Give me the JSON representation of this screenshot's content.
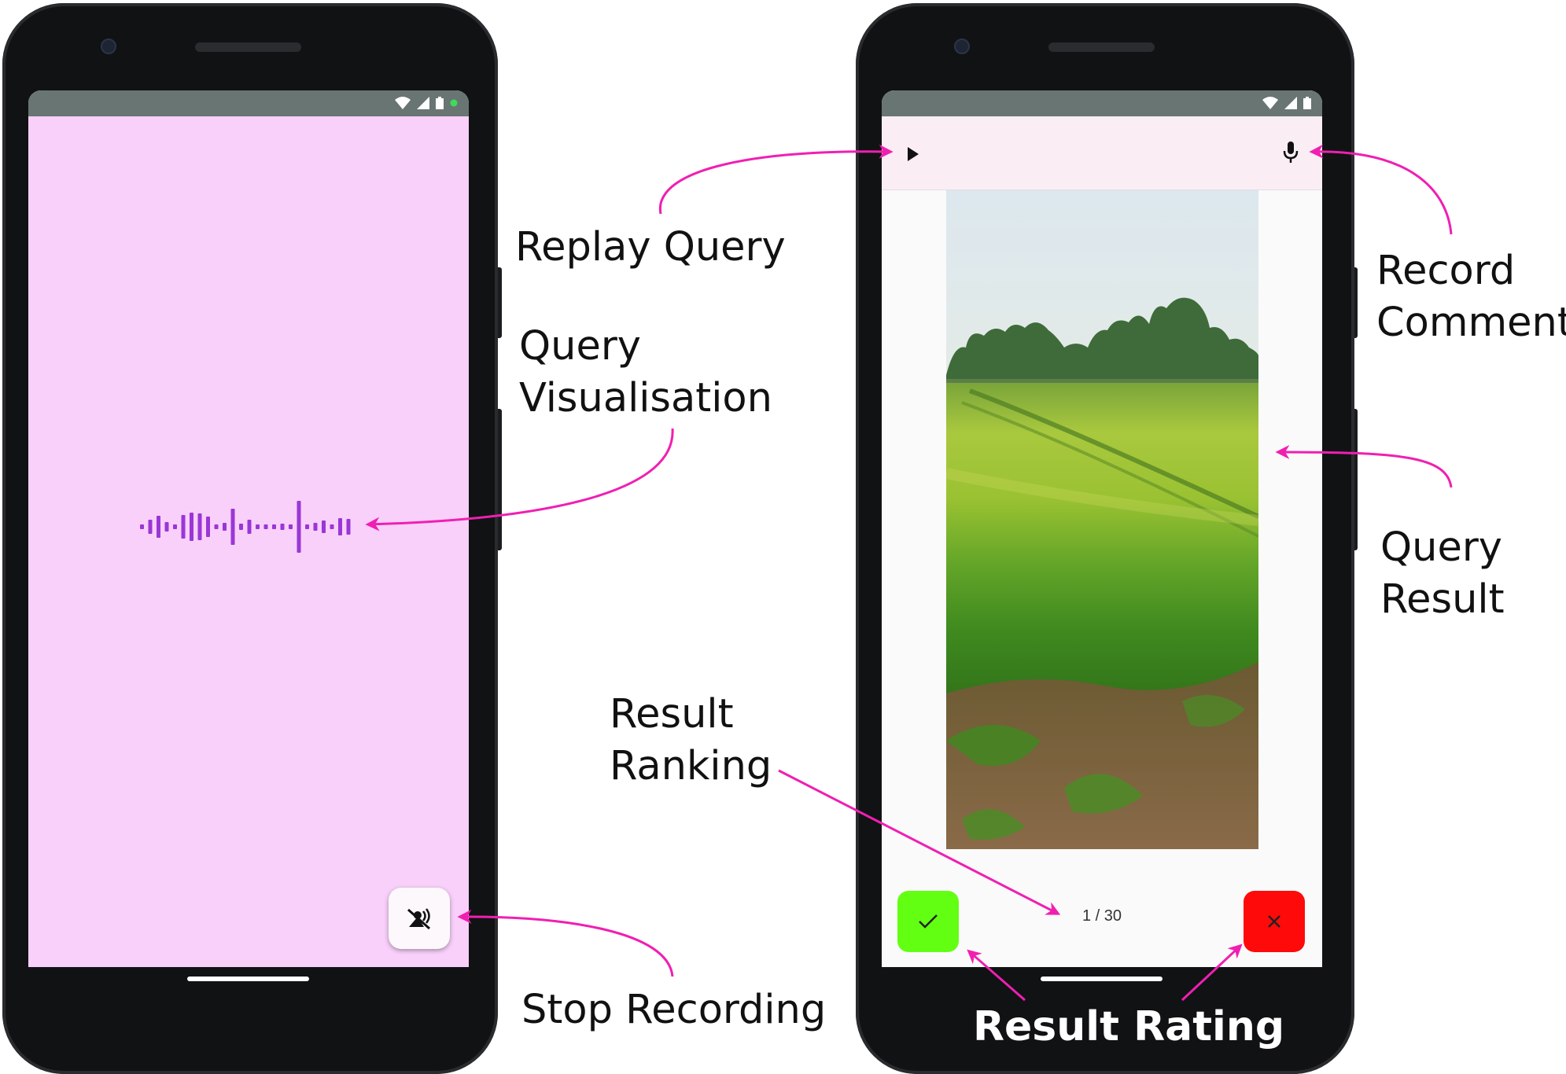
{
  "colors": {
    "accent": "#f01fb2",
    "screen_left_bg": "#f8d0fa",
    "top_bar_right": "#fbedf4",
    "waveform": "#9a36d6",
    "accept": "#62ff13",
    "reject": "#ff0a0a"
  },
  "left_phone": {
    "stop_recording_icon": "mic-off-icon",
    "waveform_icon": "audio-waveform"
  },
  "right_phone": {
    "replay_icon": "play-icon",
    "record_icon": "mic-icon",
    "ranking_text": "1 / 30",
    "accept_icon": "check-icon",
    "reject_icon": "close-icon",
    "result_image": "rice-paddy-field-photo"
  },
  "annotations": {
    "replay_query": "Replay Query",
    "query_visualisation_line1": "Query",
    "query_visualisation_line2": "Visualisation",
    "record_comment_line1": "Record",
    "record_comment_line2": "Comment",
    "query_result_line1": "Query",
    "query_result_line2": "Result",
    "result_ranking_line1": "Result",
    "result_ranking_line2": "Ranking",
    "stop_recording": "Stop Recording",
    "result_rating": "Result Rating"
  }
}
